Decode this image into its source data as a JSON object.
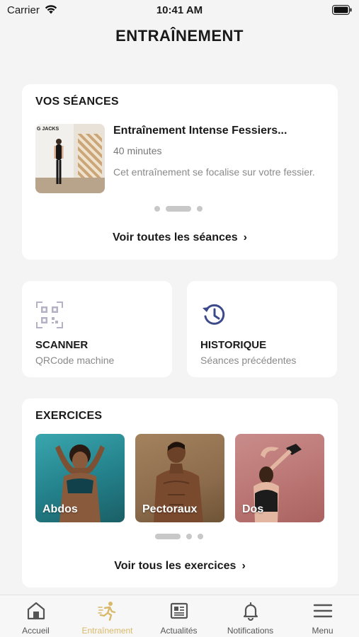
{
  "status_bar": {
    "carrier": "Carrier",
    "time": "10:41 AM"
  },
  "page": {
    "title": "ENTRAÎNEMENT"
  },
  "sessions": {
    "heading": "VOS SÉANCES",
    "thumb_text": "G JACKS",
    "title": "Entraînement Intense Fessiers...",
    "duration": "40 minutes",
    "description": "Cet entraînement se focalise sur votre fessier.",
    "link": "Voir toutes les séances",
    "active_page": 2,
    "page_count": 3
  },
  "scanner": {
    "title": "SCANNER",
    "subtitle": "QRCode machine",
    "icon": "qr-code-icon"
  },
  "history": {
    "title": "HISTORIQUE",
    "subtitle": "Séances précédentes",
    "icon": "history-clock-icon"
  },
  "exercises": {
    "heading": "EXERCICES",
    "items": [
      {
        "label": "Abdos"
      },
      {
        "label": "Pectoraux"
      },
      {
        "label": "Dos"
      }
    ],
    "link": "Voir tous les exercices",
    "active_page": 1,
    "page_count": 3
  },
  "tab_bar": {
    "items": [
      {
        "label": "Accueil",
        "icon": "home-icon"
      },
      {
        "label": "Entraînement",
        "icon": "running-icon"
      },
      {
        "label": "Actualités",
        "icon": "news-icon"
      },
      {
        "label": "Notifications",
        "icon": "bell-icon"
      },
      {
        "label": "Menu",
        "icon": "menu-icon"
      }
    ],
    "active_index": 1
  },
  "colors": {
    "accent": "#d8b96a",
    "icon_blue": "#3d4a8a",
    "background": "#f4f4f4"
  }
}
